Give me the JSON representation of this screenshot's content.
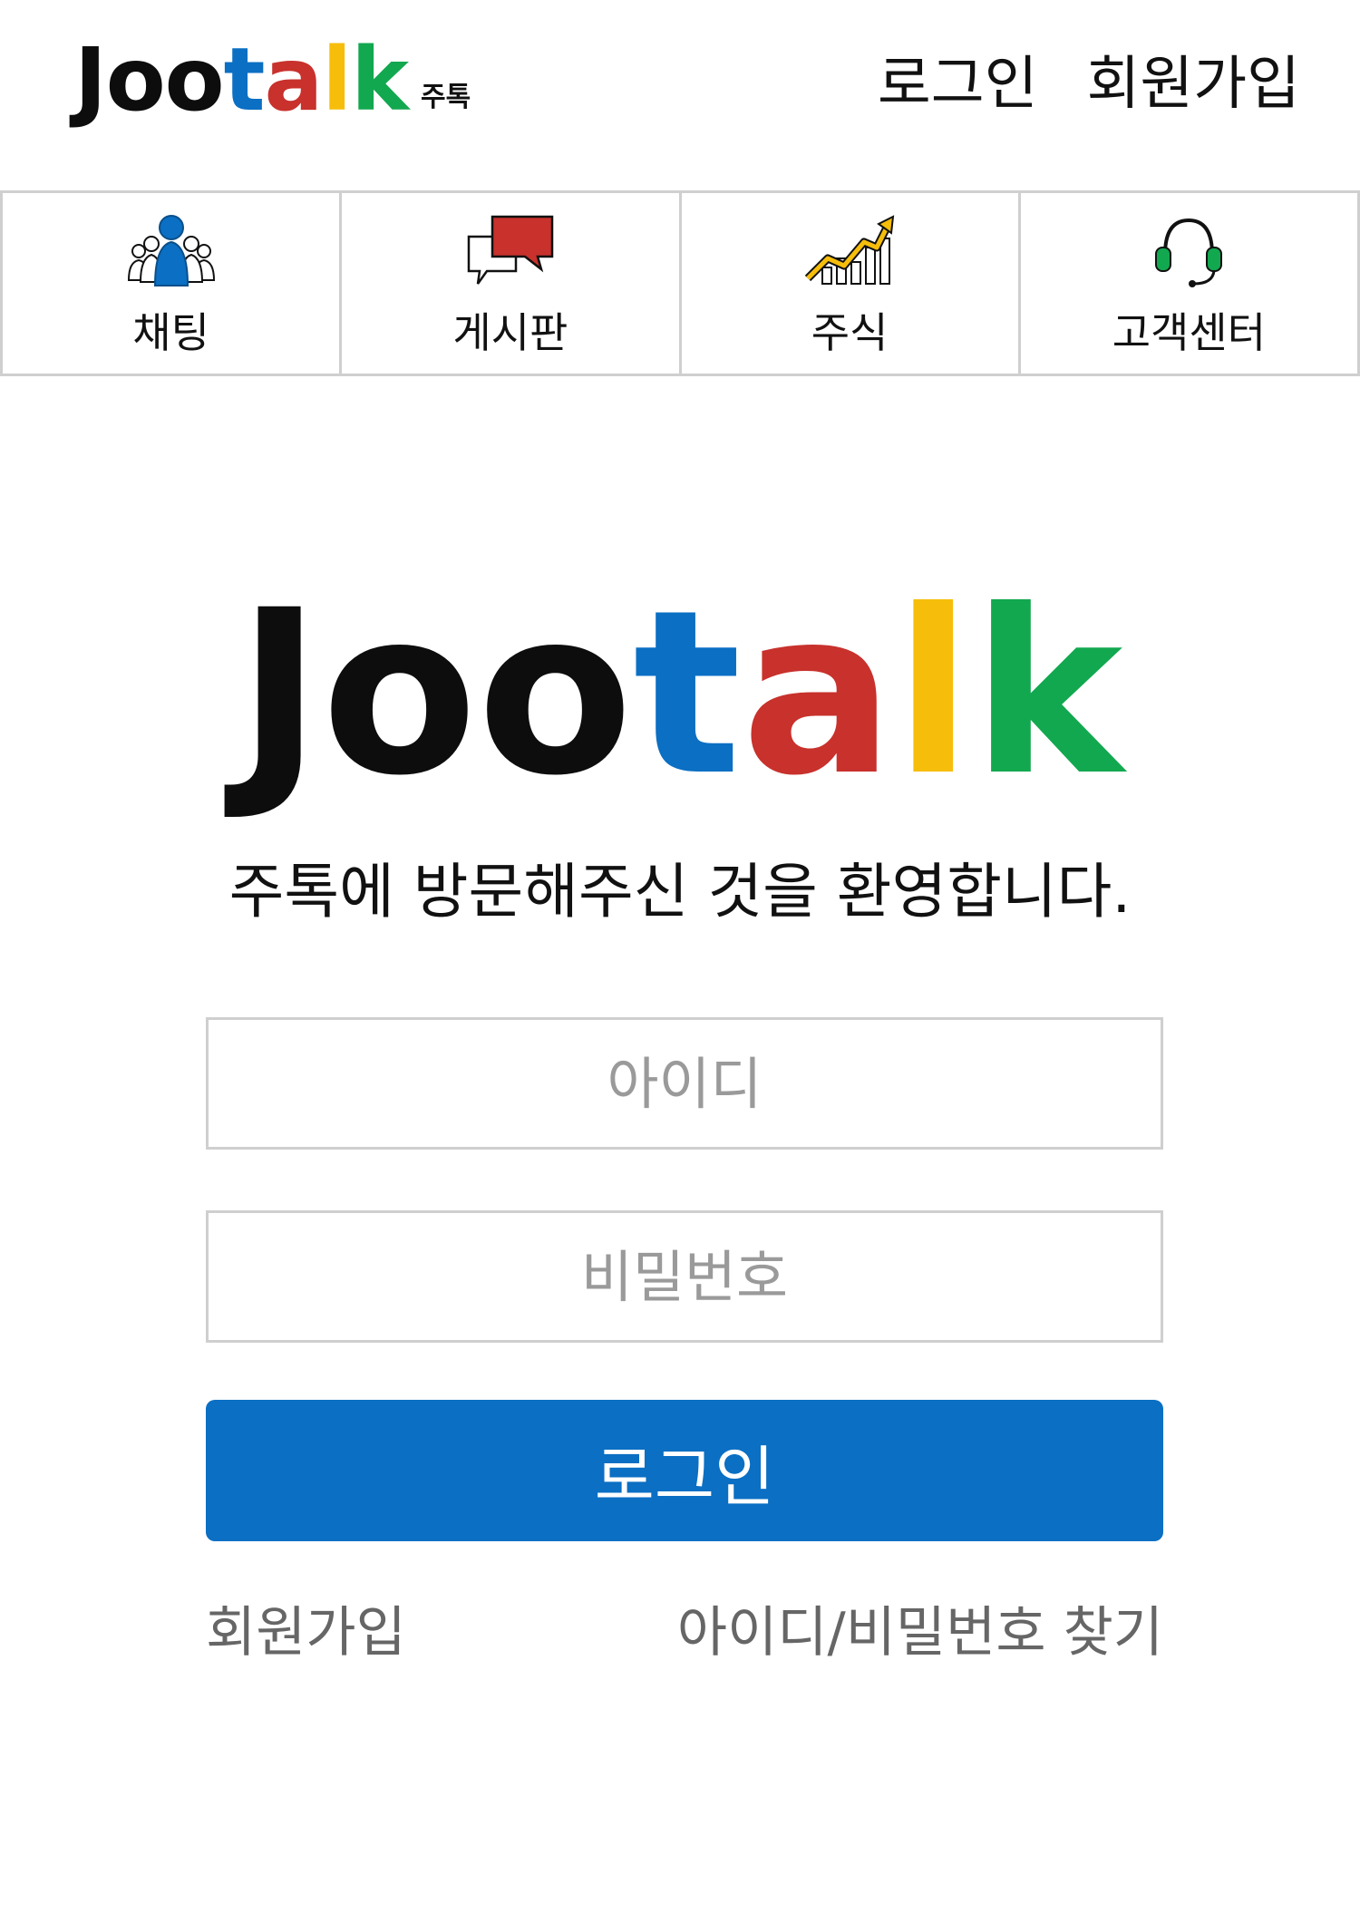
{
  "header": {
    "logo": {
      "letters": [
        "J",
        "o",
        "o",
        "t",
        "a",
        "l",
        "k"
      ],
      "colors": [
        "#0d0d0d",
        "#0d0d0d",
        "#0d0d0d",
        "#0b6fc3",
        "#c8312c",
        "#f6be0b",
        "#12a84f"
      ],
      "subtitle": "주톡"
    },
    "links": {
      "login": "로그인",
      "signup": "회원가입"
    }
  },
  "nav": {
    "items": [
      {
        "label": "채팅",
        "icon": "people-icon"
      },
      {
        "label": "게시판",
        "icon": "speech-bubbles-icon"
      },
      {
        "label": "주식",
        "icon": "stock-chart-icon"
      },
      {
        "label": "고객센터",
        "icon": "headset-icon"
      }
    ]
  },
  "hero": {
    "logo_letters": [
      "J",
      "o",
      "o",
      "t",
      "a",
      "l",
      "k"
    ],
    "welcome": "주톡에 방문해주신 것을 환영합니다."
  },
  "form": {
    "id_placeholder": "아이디",
    "password_placeholder": "비밀번호",
    "login_button": "로그인",
    "signup_link": "회원가입",
    "find_link": "아이디/비밀번호 찾기"
  },
  "colors": {
    "primary": "#0b6fc3",
    "brand_red": "#c8312c",
    "brand_yellow": "#f6be0b",
    "brand_green": "#12a84f",
    "border": "#cfcfcf"
  }
}
